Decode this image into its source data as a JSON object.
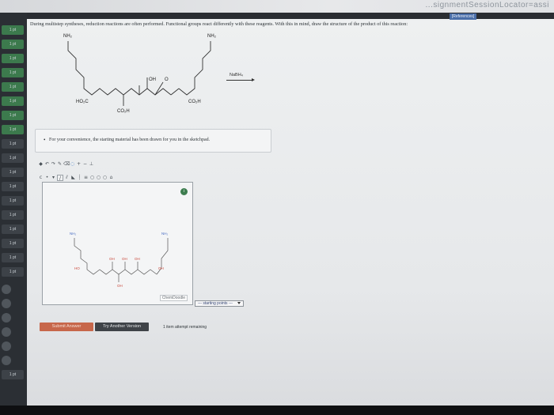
{
  "browser": {
    "url_fragment": "...signmentSessionLocator=assi"
  },
  "header": {
    "references_label": "[References]"
  },
  "question": {
    "text": "During multistep syntheses, reduction reactions are often performed. Functional groups react differently with these reagents. With this in mind, draw the structure of the product of this reaction:"
  },
  "reaction": {
    "reagent": "NaBH₄",
    "labels": {
      "nh2_left": "NH₂",
      "nh2_right": "NH₂",
      "oh": "OH",
      "o": "O",
      "ho2c": "HO₂C",
      "co2h_bottom": "CO₂H",
      "co2h_right": "CO₂H"
    }
  },
  "note": {
    "text": "For your convenience, the starting material has been drawn for you in the sketchpad."
  },
  "sketchpad": {
    "brand": "ChemDoodle",
    "labels": {
      "nh2_left": "NH₂",
      "nh2_right": "NH₂",
      "oh1": "OH",
      "oh2": "OH",
      "oh3": "OH",
      "ho": "HO",
      "oh_right": "OH",
      "oh_bottom": "OH"
    },
    "tool_icons": [
      "open-icon",
      "undo-icon",
      "pen-icon",
      "clear-icon",
      "eraser-icon",
      "zoom-icon",
      "lasso-icon",
      "bond-icon",
      "ring-icon"
    ]
  },
  "dropdown": {
    "selected": "--- starting points ---"
  },
  "actions": {
    "submit_label": "Submit Answer",
    "try_another_label": "Try Another Version",
    "attempts_text": "1 item attempt remaining"
  },
  "left_nav": {
    "item_label": "1 pt"
  }
}
